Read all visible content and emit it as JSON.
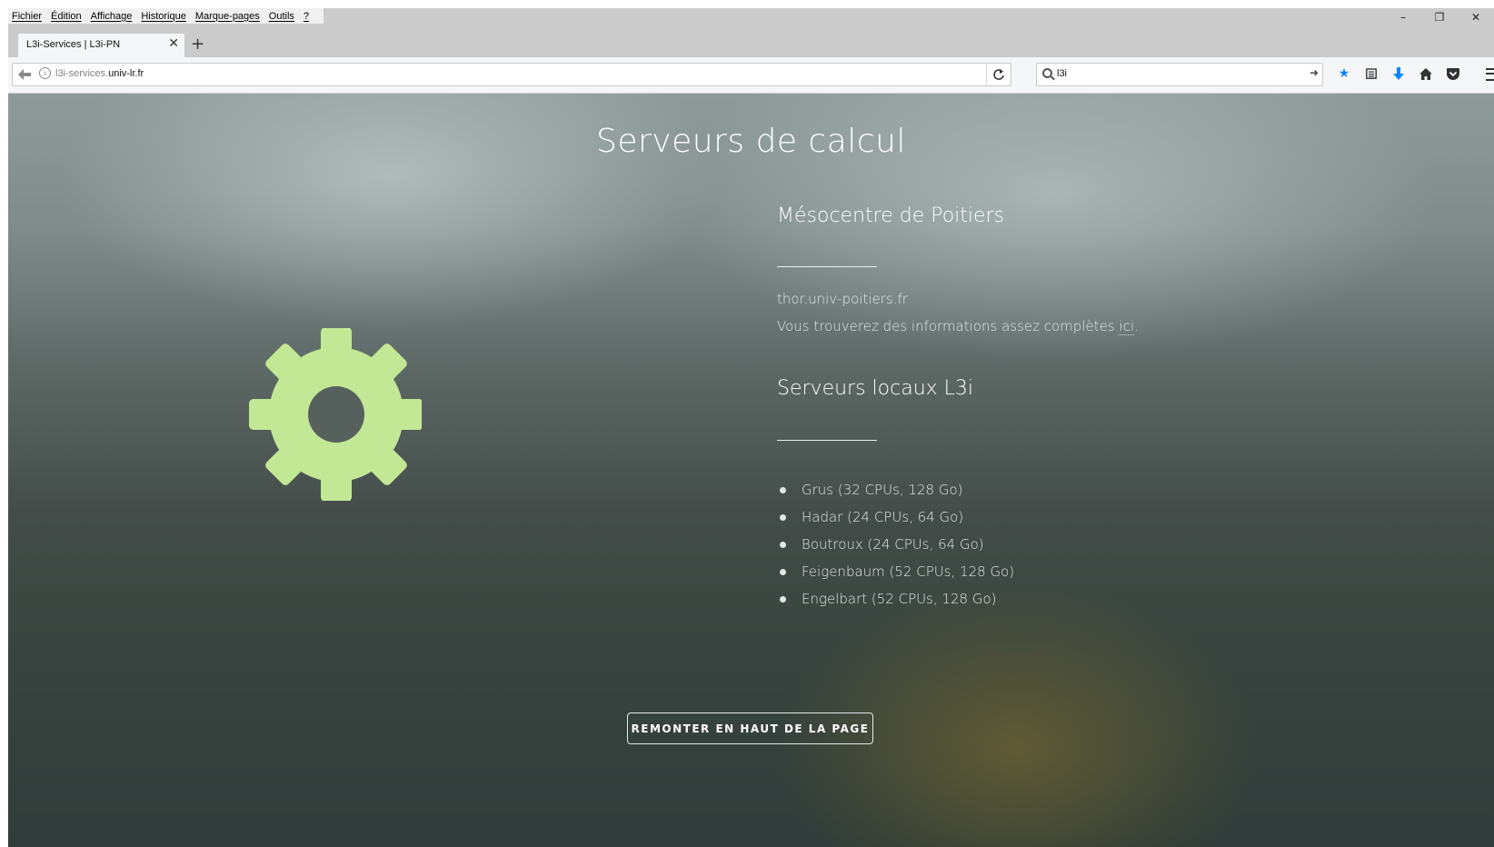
{
  "menu": {
    "items": [
      "Fichier",
      "Édition",
      "Affichage",
      "Historique",
      "Marque-pages",
      "Outils",
      "?"
    ]
  },
  "window": {
    "minimize": "–",
    "restore": "❐",
    "close": "✕"
  },
  "tab": {
    "title": "L3i-Services | L3i-PN",
    "close": "✕",
    "new_tab": "+"
  },
  "navbar": {
    "url_prefix": "l3i-services.",
    "url_domain": "univ-lr.fr",
    "search_value": "l3i"
  },
  "colors": {
    "accent_blue": "#0a84ff",
    "gear_green": "#c3e895"
  },
  "content": {
    "page_title": "Serveurs de calcul",
    "gear_icon": "gear-icon",
    "section1": {
      "heading": "Mésocentre de Poitiers",
      "host": "thor.univ-poitiers.fr",
      "info_prefix": "Vous trouverez des informations assez complètes ",
      "info_link": "ici",
      "info_suffix": "."
    },
    "section2": {
      "heading": "Serveurs locaux L3i",
      "servers": [
        "Grus (32 CPUs, 128 Go)",
        "Hadar (24 CPUs, 64 Go)",
        "Boutroux (24 CPUs, 64 Go)",
        "Feigenbaum (52 CPUs, 128 Go)",
        "Engelbart (52 CPUs, 128 Go)"
      ]
    },
    "back_to_top": "REMONTER EN HAUT DE LA PAGE"
  }
}
